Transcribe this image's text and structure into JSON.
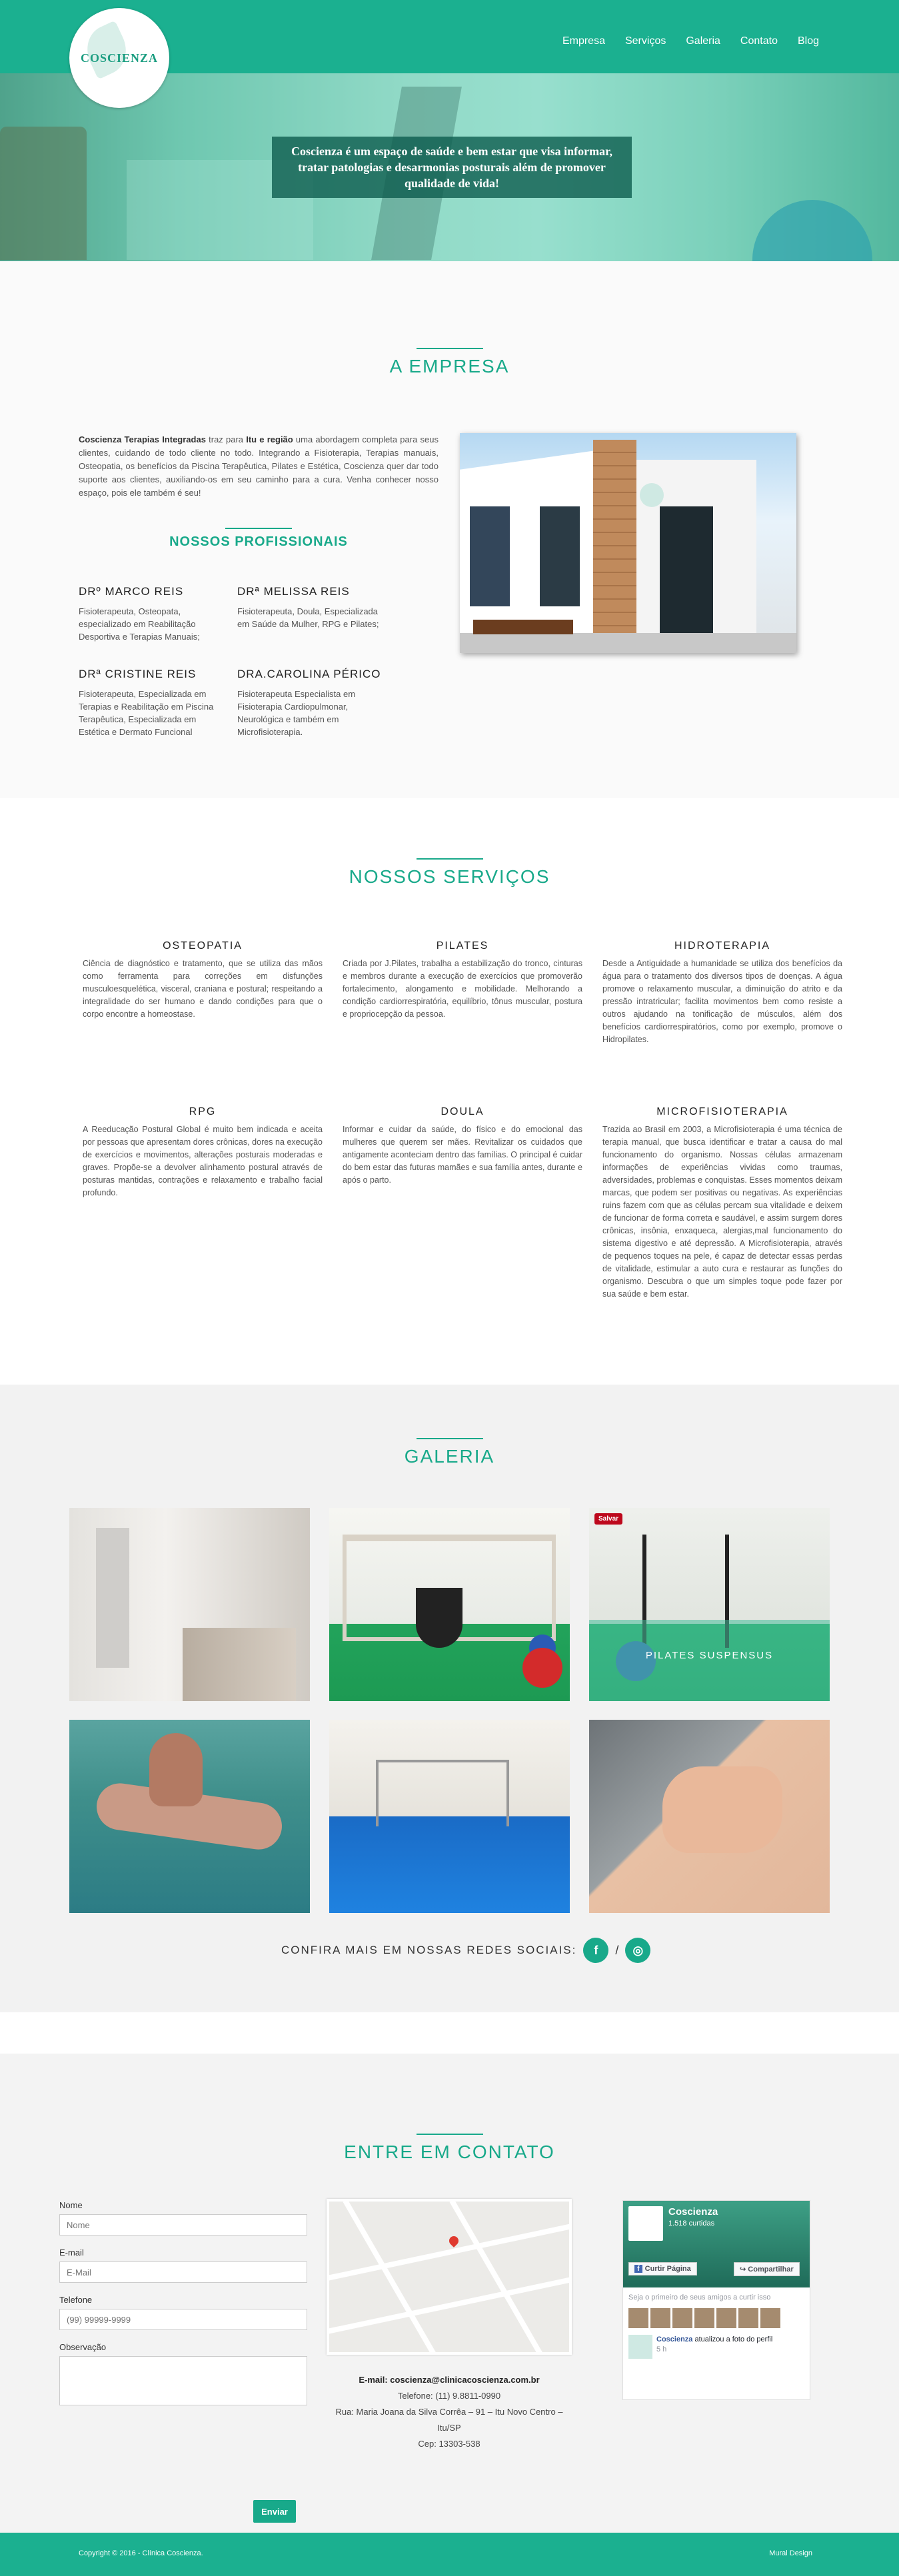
{
  "nav": {
    "logo_text": "COSCIENZA",
    "items": [
      "Empresa",
      "Serviços",
      "Galeria",
      "Contato",
      "Blog"
    ]
  },
  "hero": {
    "caption": "Coscienza é um espaço de saúde e bem estar que visa informar, tratar patologias e desarmonias posturais além de promover qualidade de vida!"
  },
  "empresa": {
    "title": "A EMPRESA",
    "intro_bold1": "Coscienza Terapias Integradas",
    "intro_mid1": " traz para ",
    "intro_bold2": "Itu e região",
    "intro_rest": " uma abordagem completa para seus clientes, cuidando de todo cliente no todo. Integrando a Fisioterapia, Terapias manuais, Osteopatia, os benefícios da Piscina Terapêutica, Pilates e Estética, Coscienza quer dar todo suporte aos clientes, auxiliando-os em seu caminho para a cura. Venha conhecer nosso espaço, pois ele também é seu!",
    "prof_title": "NOSSOS PROFISSIONAIS",
    "profissionais": [
      {
        "name": "DRº MARCO REIS",
        "desc": "Fisioterapeuta, Osteopata, especializado em Reabilitação Desportiva e Terapias Manuais;"
      },
      {
        "name": "DRª MELISSA REIS",
        "desc": "Fisioterapeuta, Doula, Especializada em Saúde da Mulher, RPG e Pilates;"
      },
      {
        "name": "DRª CRISTINE REIS",
        "desc": "Fisioterapeuta, Especializada em Terapias e Reabilitação em Piscina Terapêutica, Especializada em Estética e Dermato Funcional"
      },
      {
        "name": "DRA.CAROLINA PÉRICO",
        "desc": "Fisioterapeuta Especialista em Fisioterapia Cardiopulmonar, Neurológica e também em Microfisioterapia."
      }
    ]
  },
  "servicos": {
    "title": "NOSSOS SERVIÇOS",
    "items": [
      {
        "name": "OSTEOPATIA",
        "desc": "Ciência de diagnóstico e tratamento, que se utiliza das mãos como ferramenta para correções em disfunções musculoesquelética, visceral, craniana e postural; respeitando a integralidade do ser humano e dando condições para que o corpo encontre a homeostase."
      },
      {
        "name": "PILATES",
        "desc": "Criada por J.Pilates, trabalha a estabilização do tronco, cinturas e membros durante a execução de exercícios que promoverão fortalecimento, alongamento e mobilidade. Melhorando a condição cardiorrespiratória, equilíbrio, tônus muscular, postura e propriocepção da pessoa."
      },
      {
        "name": "HIDROTERAPIA",
        "desc": "Desde a Antiguidade a humanidade se utiliza dos benefícios da água para o tratamento dos diversos tipos de doenças. A água promove o relaxamento muscular, a diminuição do atrito e da pressão intratricular; facilita movimentos bem como resiste a outros ajudando na tonificação de músculos, além dos benefícios cardiorrespiratórios, como por exemplo, promove o Hidropilates."
      },
      {
        "name": "RPG",
        "desc": "A Reeducação Postural Global é muito bem indicada e aceita por pessoas que apresentam dores crônicas, dores na execução de exercícios e movimentos, alterações posturais moderadas e graves. Propõe-se a devolver alinhamento postural através de posturas mantidas, contrações e relaxamento e trabalho facial profundo."
      },
      {
        "name": "DOULA",
        "desc": "Informar e cuidar da saúde, do físico e do emocional das mulheres que querem ser mães. Revitalizar os cuidados que antigamente aconteciam dentro das famílias. O principal é cuidar do bem estar das futuras mamães e sua família antes, durante e após o parto."
      },
      {
        "name": "MICROFISIOTERAPIA",
        "desc": "Trazida ao Brasil em 2003, a Microfisioterapia é uma técnica de terapia manual, que busca identificar e tratar a causa do mal funcionamento do organismo. Nossas células armazenam informações de experiências vividas como traumas, adversidades, problemas e conquistas. Esses momentos deixam marcas, que podem ser positivas ou negativas. As experiências ruins fazem com que as células percam sua vitalidade e deixem de funcionar de forma correta e saudável, e assim surgem dores crônicas, insônia, enxaqueca, alergias,mal funcionamento do sistema digestivo e até depressão. A Microfisioterapia, através de pequenos toques na pele, é capaz de detectar essas perdas de vitalidade, estimular a auto cura e restaurar as funções do organismo. Descubra o que um simples toque pode fazer por sua saúde e bem estar."
      }
    ]
  },
  "galeria": {
    "title": "GALERIA",
    "caption_pilates": "PILATES SUSPENSUS",
    "salvar": "Salvar",
    "redes_label": "CONFIRA MAIS EM NOSSAS REDES SOCIAIS:",
    "separator": "/",
    "facebook_glyph": "f",
    "instagram_glyph": "◎"
  },
  "contato": {
    "title": "ENTRE EM CONTATO",
    "form": {
      "nome_label": "Nome",
      "nome_placeholder": "Nome",
      "email_label": "E-mail",
      "email_placeholder": "E-Mail",
      "tel_label": "Telefone",
      "tel_placeholder": "(99) 99999-9999",
      "obs_label": "Observação",
      "submit": "Enviar"
    },
    "email": "E-mail: coscienza@clinicacoscienza.com.br",
    "phone": "Telefone: (11) 9.8811-0990",
    "address": "Rua: Maria Joana da Silva Corrêa – 91 – Itu Novo Centro – Itu/SP",
    "cep": "Cep: 13303-538",
    "facebook": {
      "page_name": "Coscienza",
      "likes": "1.518 curtidas",
      "like_btn": "Curtir Página",
      "share_btn": "Compartilhar",
      "friends_text": "Seja o primeiro de seus amigos a curtir isso",
      "post_name": "Coscienza",
      "post_text": " atualizou a foto do perfil",
      "post_time": "5 h"
    }
  },
  "footer": {
    "copyright": "Copyright © 2016 - Clínica Coscienza.",
    "credit": "Mural Design"
  },
  "colors": {
    "accent": "#1bb090",
    "accent_dark": "#18a98a"
  }
}
